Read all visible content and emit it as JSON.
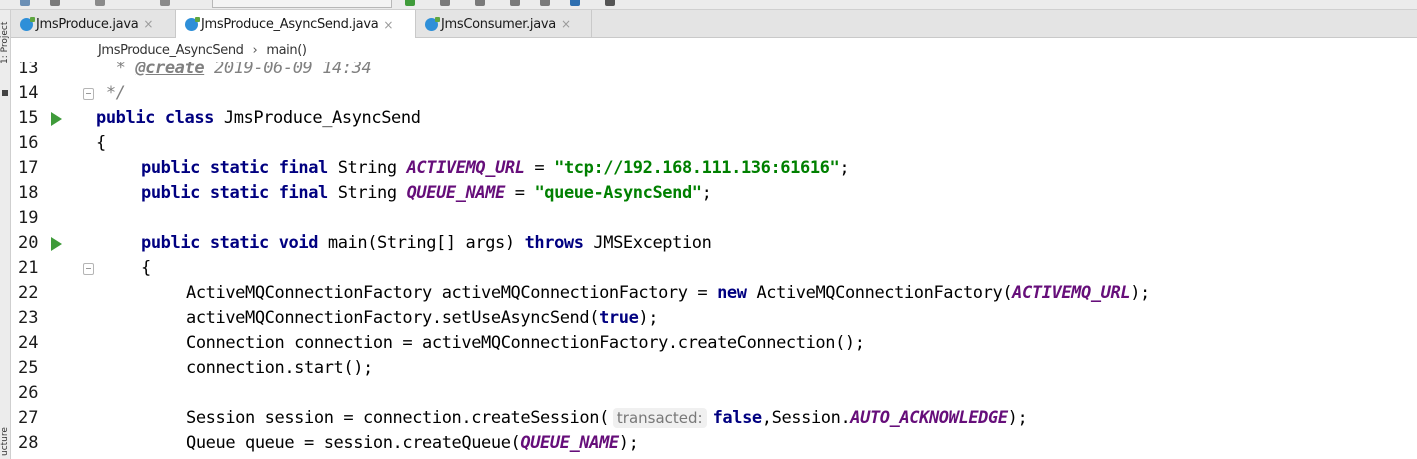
{
  "tabs": [
    {
      "label": "JmsProduce.java",
      "close": "×",
      "active": false
    },
    {
      "label": "JmsProduce_AsyncSend.java",
      "close": "×",
      "active": true
    },
    {
      "label": "JmsConsumer.java",
      "close": "×",
      "active": false
    }
  ],
  "breadcrumb": {
    "file": "JmsProduce_AsyncSend",
    "separator": "›",
    "method": "main()"
  },
  "side_strip": {
    "top_label": "1: Project",
    "bottom_label": "ucture"
  },
  "colors": {
    "keyword": "#000080",
    "string": "#008000",
    "constant": "#660e7a",
    "comment": "#808080",
    "run_icon": "#3f9b3a"
  },
  "lines": [
    {
      "num": "13",
      "c1": "  * ",
      "c2": "@create",
      "c3": " 2019-06-09 14:34"
    },
    {
      "num": "14",
      "c1": " */"
    },
    {
      "num": "15",
      "kw1": "public class",
      "c1": " JmsProduce_AsyncSend"
    },
    {
      "num": "16",
      "c1": "{"
    },
    {
      "num": "17",
      "kw1": "public static final",
      "c1": " String ",
      "const1": "ACTIVEMQ_URL",
      "c2": " = ",
      "str1": "\"tcp://192.168.111.136:61616\"",
      "c3": ";"
    },
    {
      "num": "18",
      "kw1": "public static final",
      "c1": " String ",
      "const1": "QUEUE_NAME",
      "c2": " = ",
      "str1": "\"queue-AsyncSend\"",
      "c3": ";"
    },
    {
      "num": "19"
    },
    {
      "num": "20",
      "kw1": "public static void",
      "c1": " main(String[] args) ",
      "kw2": "throws",
      "c2": " JMSException"
    },
    {
      "num": "21",
      "c1": "{"
    },
    {
      "num": "22",
      "c1": "ActiveMQConnectionFactory activeMQConnectionFactory = ",
      "kw1": "new",
      "c2": " ActiveMQConnectionFactory(",
      "const1": "ACTIVEMQ_URL",
      "c3": ");"
    },
    {
      "num": "23",
      "c1": "activeMQConnectionFactory.setUseAsyncSend(",
      "kw1": "true",
      "c2": ");"
    },
    {
      "num": "24",
      "c1": "Connection connection = activeMQConnectionFactory.createConnection();"
    },
    {
      "num": "25",
      "c1": "connection.start();"
    },
    {
      "num": "26"
    },
    {
      "num": "27",
      "c1": "Session session = connection.createSession(",
      "hint": "transacted:",
      "kw1": "false",
      "c2": ",Session.",
      "const1": "AUTO_ACKNOWLEDGE",
      "c3": ");"
    },
    {
      "num": "28",
      "c1": "Queue queue = session.createQueue(",
      "const1": "QUEUE_NAME",
      "c2": ");"
    }
  ]
}
